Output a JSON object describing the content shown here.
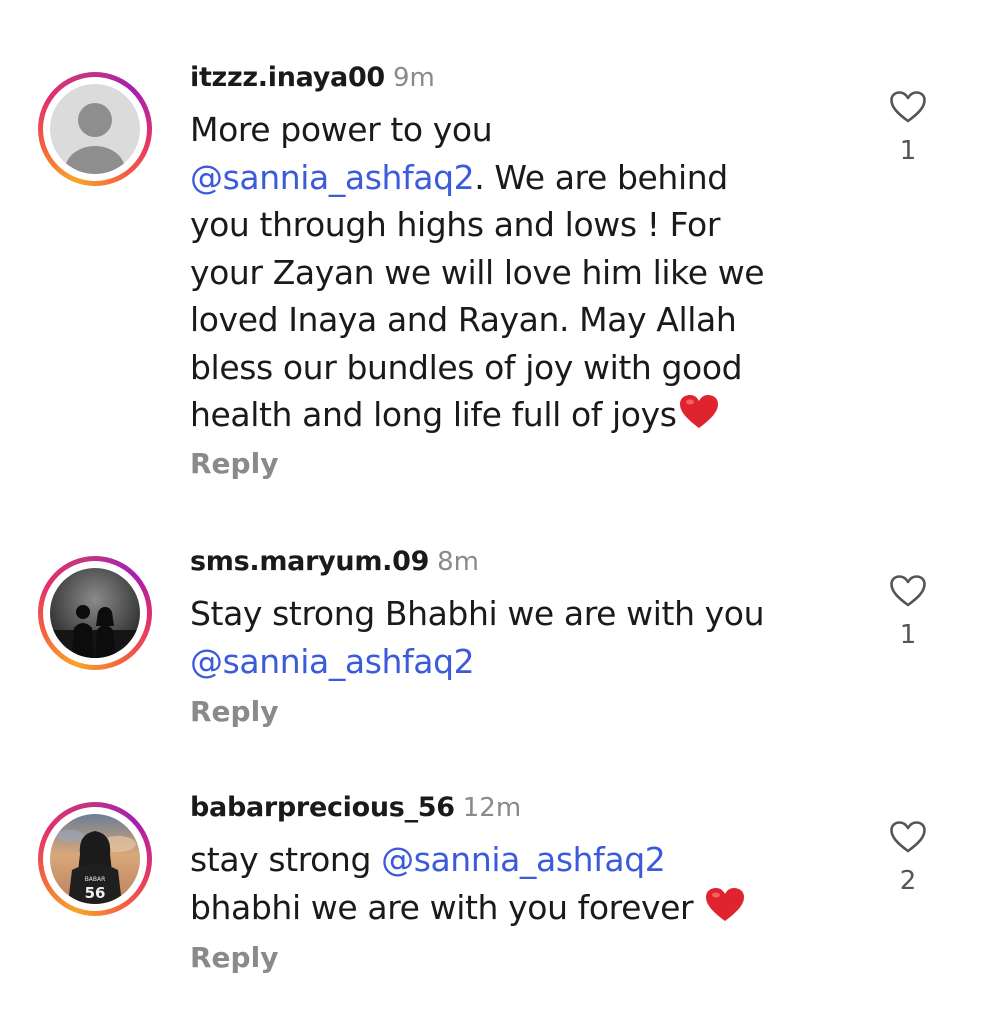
{
  "comments": [
    {
      "username": "itzzz.inaya00",
      "time": "9m",
      "line1": "More power to you",
      "mention": "@sannia_ashfaq2",
      "line2_rest": ". We are behind",
      "line3": "you through highs and lows ! For",
      "line4": "your Zayan we will love him like we",
      "line5": "loved Inaya and Rayan. May Allah",
      "line6": "bless our bundles of joy with good",
      "line7": "health and long life full of joys",
      "reply": "Reply",
      "likes": "1",
      "avatar": "default-avatar"
    },
    {
      "username": "sms.maryum.09",
      "time": "8m",
      "line1": "Stay strong Bhabhi we are with you",
      "mention": "@sannia_ashfaq2",
      "reply": "Reply",
      "likes": "1",
      "avatar": "couple-silhouette-photo"
    },
    {
      "username": "babarprecious_56",
      "time": "12m",
      "line1_prefix": "stay strong ",
      "mention": "@sannia_ashfaq2",
      "line2": "bhabhi we are with you forever ",
      "reply": "Reply",
      "likes": "2",
      "avatar": "jersey-56-photo"
    }
  ],
  "colors": {
    "mention": "#3b5bdb",
    "muted": "#8a8a8a",
    "heart_emoji": "#e0242f"
  },
  "icons": {
    "like": "heart-outline-icon",
    "emoji": "red-heart-emoji"
  }
}
